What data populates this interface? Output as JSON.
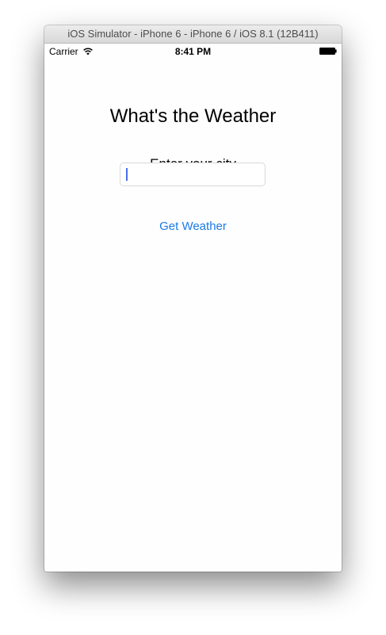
{
  "window": {
    "title": "iOS Simulator - iPhone 6 - iPhone 6 / iOS 8.1 (12B411)"
  },
  "status_bar": {
    "carrier": "Carrier",
    "time": "8:41 PM",
    "wifi_icon": "wifi-icon",
    "battery_icon": "battery-icon",
    "battery_level": 1.0
  },
  "app": {
    "title": "What's the Weather",
    "prompt": "Enter your city",
    "city_input": {
      "value": "",
      "placeholder": ""
    },
    "button_label": "Get Weather"
  },
  "colors": {
    "link_blue": "#1a7ae8",
    "caret": "#4a6ee8"
  }
}
